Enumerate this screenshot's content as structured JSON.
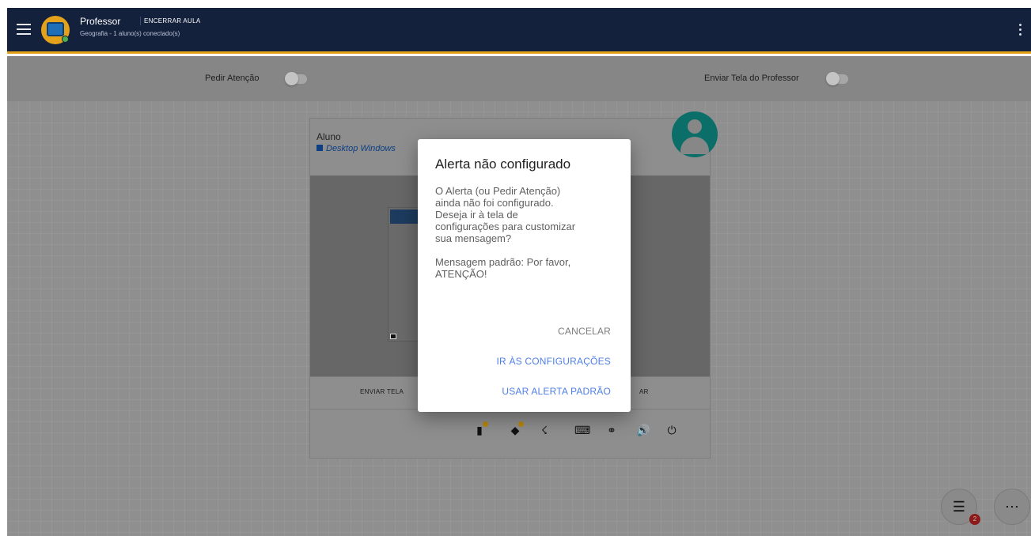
{
  "appbar": {
    "title": "Professor",
    "end_class": "ENCERRAR AULA",
    "subtitle": "Geografia - 1 aluno(s) conectado(s)"
  },
  "toggles": {
    "ask_attention": "Pedir Atenção",
    "send_teacher_screen": "Enviar Tela do Professor"
  },
  "card": {
    "student": "Aluno",
    "device": "Desktop Windows",
    "send_screen": "ENVIAR TELA",
    "other_action": "AR"
  },
  "dialog": {
    "title": "Alerta não configurado",
    "body": "O Alerta (ou Pedir Atenção)\nainda não foi configurado.\nDeseja ir à tela de\nconfigurações para customizar\nsua mensagem?\n\nMensagem padrão: Por favor,\nATENÇÃO!",
    "cancel": "CANCELAR",
    "go_settings": "IR ÀS CONFIGURAÇÕES",
    "use_default": "USAR ALERTA PADRÃO"
  },
  "fab": {
    "list_badge": "2"
  },
  "icons": {
    "card_icons": [
      "tablet-alert-icon",
      "chat-alert-icon",
      "clean-icon",
      "keyboard-icon",
      "link-icon",
      "volume-icon",
      "power-icon"
    ]
  },
  "colors": {
    "appbar_bg": "#14213d",
    "appbar_accent": "#e3a21a",
    "dialog_link": "#4f7fe6",
    "avatar": "#0c6e69"
  }
}
